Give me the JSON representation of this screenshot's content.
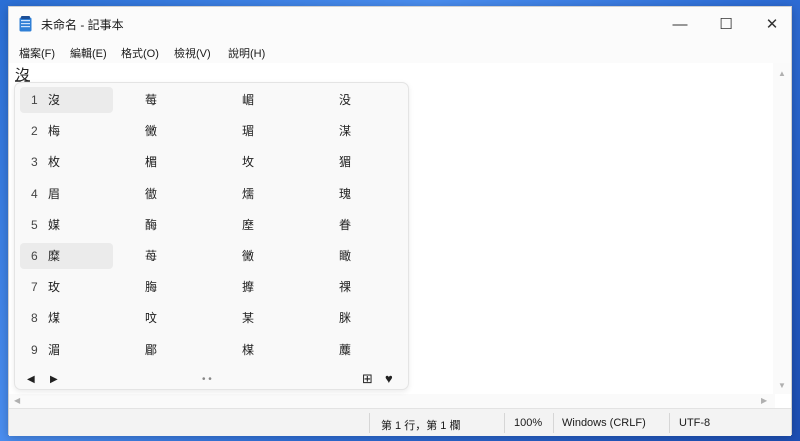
{
  "window": {
    "title": "未命名 - 記事本",
    "controls": {
      "minimize": "—",
      "maximize": "☐",
      "close": "✕"
    }
  },
  "menu": [
    {
      "label": "檔案(F)"
    },
    {
      "label": "編輯(E)"
    },
    {
      "label": "格式(O)"
    },
    {
      "label": "檢視(V)"
    },
    {
      "label": "說明(H)"
    }
  ],
  "editor": {
    "text": "沒"
  },
  "ime": {
    "rows": [
      {
        "num": "1",
        "cols": [
          "沒",
          "莓",
          "嵋",
          "没"
        ]
      },
      {
        "num": "2",
        "cols": [
          "梅",
          "黴",
          "瑂",
          "湈"
        ]
      },
      {
        "num": "3",
        "cols": [
          "枚",
          "楣",
          "坆",
          "猸"
        ]
      },
      {
        "num": "4",
        "cols": [
          "眉",
          "徾",
          "燸",
          "瑰"
        ]
      },
      {
        "num": "5",
        "cols": [
          "媒",
          "酶",
          "塺",
          "眷"
        ]
      },
      {
        "num": "6",
        "cols": [
          "糜",
          "苺",
          "黴",
          "瞰"
        ]
      },
      {
        "num": "7",
        "cols": [
          "玫",
          "脢",
          "擵",
          "祼"
        ]
      },
      {
        "num": "8",
        "cols": [
          "煤",
          "呅",
          "某",
          "脒"
        ]
      },
      {
        "num": "9",
        "cols": [
          "湄",
          "郿",
          "楳",
          "蘪"
        ]
      }
    ],
    "highlighted_rows": [
      0,
      5
    ],
    "footer": {
      "prev": "◀",
      "next": "▶",
      "pager": "• •",
      "expand": "⊞",
      "favorite": "♥"
    }
  },
  "status": {
    "position": "第 1 行，第 1 欄",
    "zoom": "100%",
    "line_ending": "Windows (CRLF)",
    "encoding": "UTF-8"
  },
  "colors": {
    "accent": "#1a63c9",
    "desktop": "#2b6fd6"
  }
}
